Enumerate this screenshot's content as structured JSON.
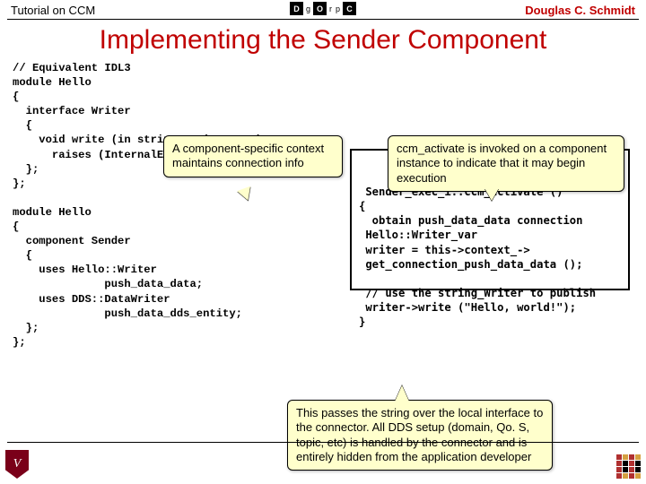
{
  "header": {
    "left": "Tutorial on CCM",
    "right": "Douglas C. Schmidt",
    "logo": {
      "d": "D",
      "o": "O",
      "c": "C",
      "g": "g",
      "r": "r",
      "p": "p"
    }
  },
  "title": "Implementing the Sender Component",
  "code_left": "// Equivalent IDL3\nmodule Hello\n{\n  interface Writer\n  {\n    void write (in string an_instance)\n      raises (InternalError);\n  };\n};\n\nmodule Hello\n{\n  component Sender\n  {\n    uses Hello::Writer\n              push_data_data;\n    uses DDS::DataWriter\n              push_data_dds_entity;\n  };\n};",
  "code_right": " Sender_exec_i::ccm_activate ()\n{\n  obtain push_data_data connection\n Hello::Writer_var\n writer = this->context_->\n get_connection_push_data_data ();\n\n // use the string_Writer to publish\n writer->write (\"Hello, world!\");\n}",
  "callouts": {
    "c1": "A component-specific context maintains connection info",
    "c2": "ccm_activate is invoked on a component instance to indicate that it may begin execution",
    "c3": "This passes the string over the local interface to the connector.  All DDS setup (domain, Qo. S, topic, etc) is handled by the connector and is entirely hidden from the application developer"
  },
  "footer": {
    "shield": "V"
  }
}
